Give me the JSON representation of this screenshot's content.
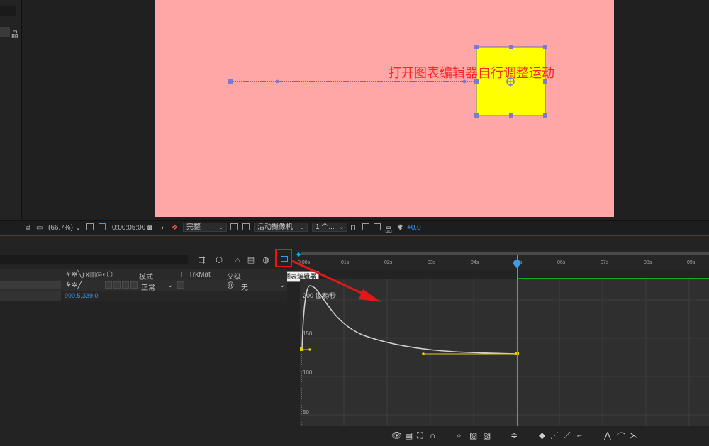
{
  "viewer": {
    "zoom": "(66.7%)",
    "timecode": "0:00:05:00",
    "resolution": "完整",
    "camera": "活动摄像机",
    "views": "1 个...",
    "exposure": "+0.0"
  },
  "timeline": {
    "graph_editor_tooltip": "图表编辑器",
    "columns": {
      "mode": "模式",
      "t": "T",
      "trkmat": "TrkMat",
      "parent": "父级"
    },
    "layer": {
      "mode": "正常",
      "parent": "无"
    },
    "position_value": "990.5,339.0",
    "ruler_ticks": [
      "0:00s",
      "01s",
      "02s",
      "03s",
      "04s",
      "05s",
      "06s",
      "07s",
      "08s",
      "09s"
    ],
    "current_time_seconds": 5,
    "graph_unit_label": "200 像素/秒",
    "graph_y_labels": [
      "150",
      "100",
      "50"
    ],
    "keyframe_values": {
      "start": 130,
      "end": 130,
      "peak": 200
    }
  },
  "annotation": "打开图表编辑器自行调整运动",
  "colors": {
    "comp_background": "#ffa7a7",
    "solid_layer": "#ffff00",
    "annotation_red": "#ff2525",
    "playhead_blue": "#3d9bef",
    "curve_yellow": "#e0d400"
  }
}
